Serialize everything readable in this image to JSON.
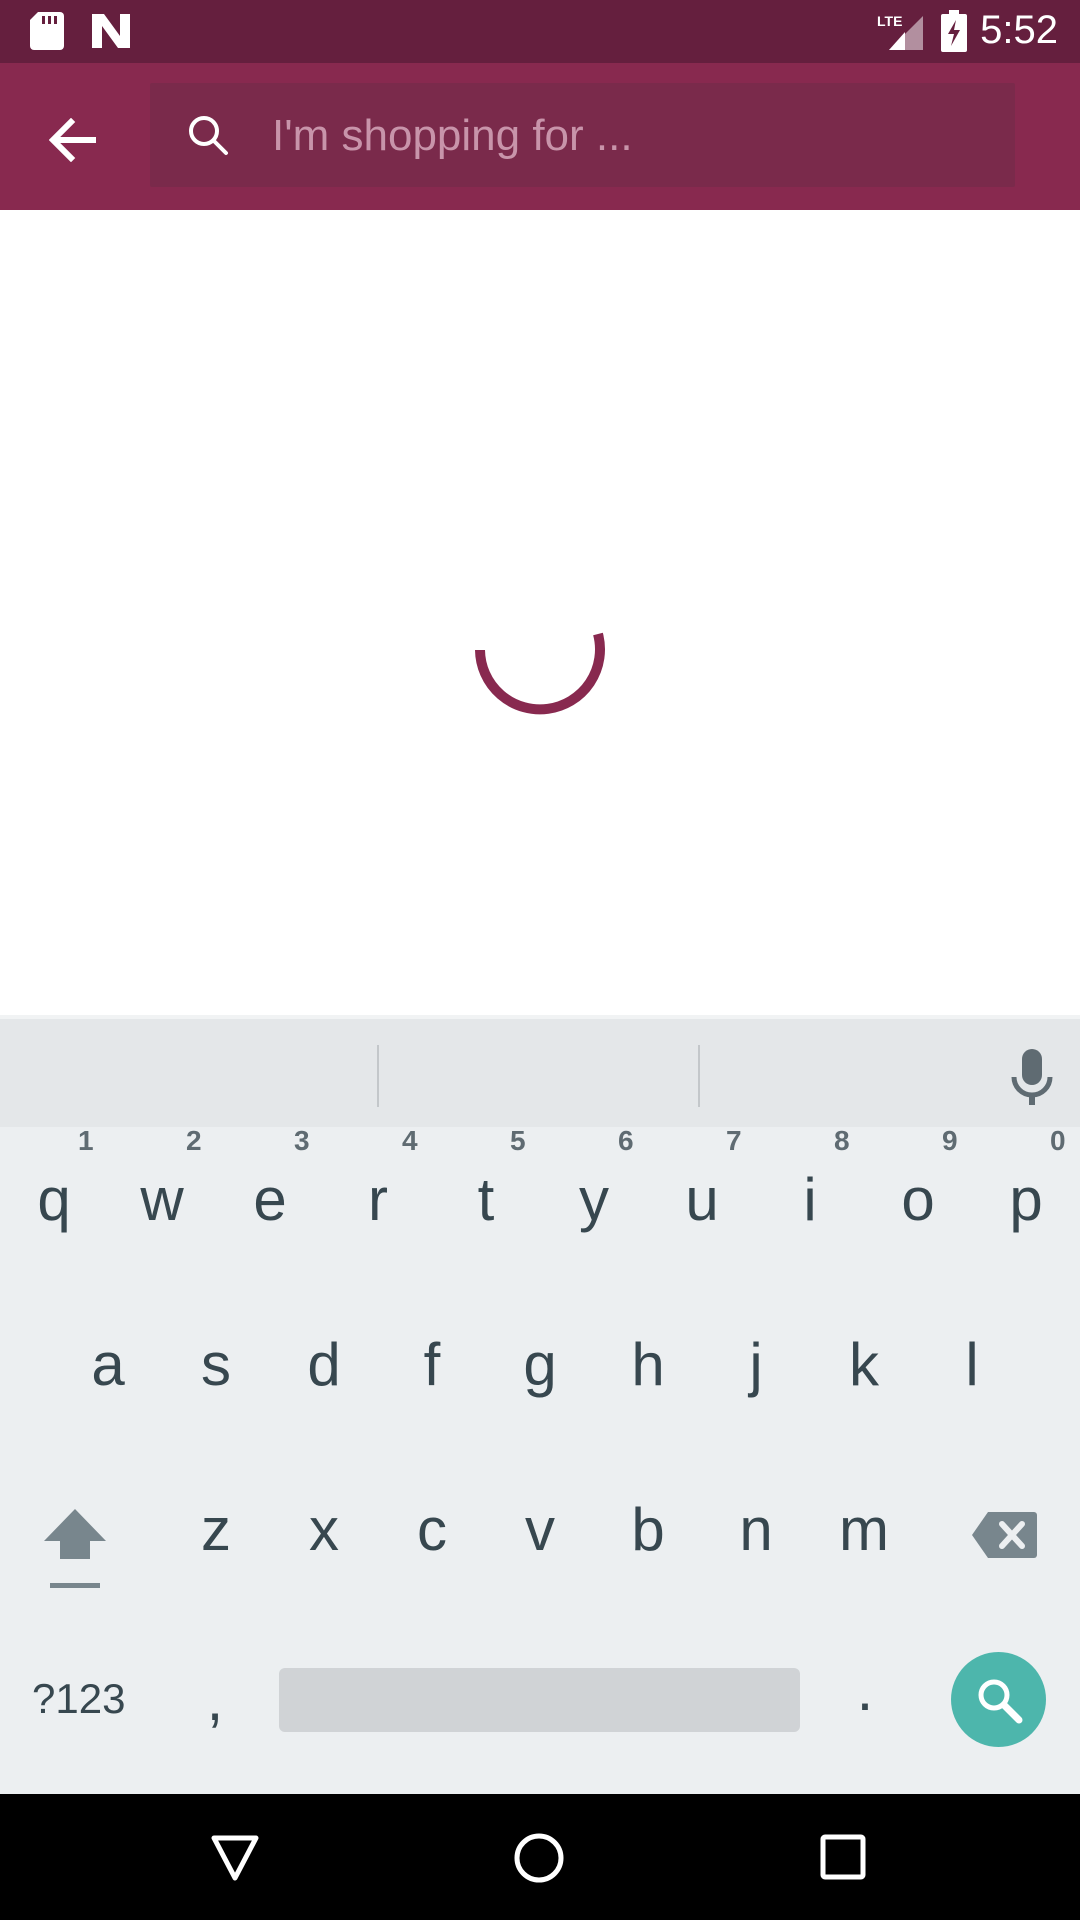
{
  "status_bar": {
    "time": "5:52",
    "network": "LTE"
  },
  "search": {
    "placeholder": "I'm shopping for ..."
  },
  "colors": {
    "brand": "#88294f",
    "status_bar": "#651f3e",
    "accent": "#4db6ac"
  },
  "keyboard": {
    "row1": [
      "q",
      "w",
      "e",
      "r",
      "t",
      "y",
      "u",
      "i",
      "o",
      "p"
    ],
    "row1_hints": [
      "1",
      "2",
      "3",
      "4",
      "5",
      "6",
      "7",
      "8",
      "9",
      "0"
    ],
    "row2": [
      "a",
      "s",
      "d",
      "f",
      "g",
      "h",
      "j",
      "k",
      "l"
    ],
    "row3": [
      "z",
      "x",
      "c",
      "v",
      "b",
      "n",
      "m"
    ],
    "symbols_label": "?123",
    "comma": ",",
    "period": "."
  },
  "icons": {
    "back": "arrow-left-icon",
    "search": "search-icon",
    "mic": "mic-icon",
    "shift": "shift-icon",
    "delete": "backspace-icon",
    "nav_back": "triangle-back-icon",
    "nav_home": "circle-home-icon",
    "nav_recents": "square-recents-icon"
  }
}
